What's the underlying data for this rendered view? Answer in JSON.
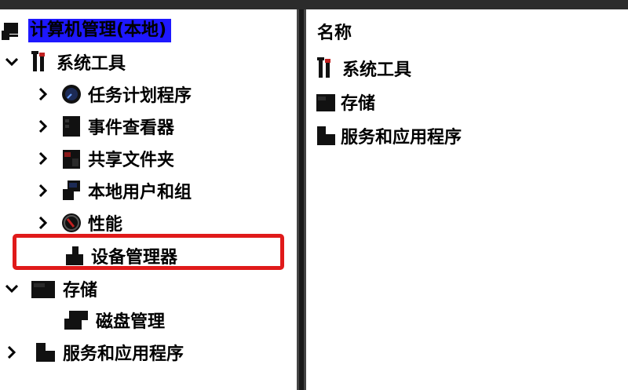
{
  "tree": {
    "root": {
      "label": "计算机管理(本地)",
      "icon": "computer-management-icon"
    },
    "items": [
      {
        "label": "系统工具",
        "icon": "tools-icon",
        "state": "expanded"
      },
      {
        "label": "任务计划程序",
        "icon": "clock-icon",
        "state": "collapsed"
      },
      {
        "label": "事件查看器",
        "icon": "event-viewer-icon",
        "state": "collapsed"
      },
      {
        "label": "共享文件夹",
        "icon": "shared-folder-icon",
        "state": "collapsed"
      },
      {
        "label": "本地用户和组",
        "icon": "users-icon",
        "state": "collapsed"
      },
      {
        "label": "性能",
        "icon": "performance-icon",
        "state": "collapsed"
      },
      {
        "label": "设备管理器",
        "icon": "device-manager-icon",
        "state": "none"
      },
      {
        "label": "存储",
        "icon": "storage-icon",
        "state": "expanded"
      },
      {
        "label": "磁盘管理",
        "icon": "disk-icon",
        "state": "none"
      },
      {
        "label": "服务和应用程序",
        "icon": "services-icon",
        "state": "collapsed"
      }
    ]
  },
  "list": {
    "header": "名称",
    "items": [
      {
        "label": "系统工具",
        "icon": "tools-icon"
      },
      {
        "label": "存储",
        "icon": "storage-icon"
      },
      {
        "label": "服务和应用程序",
        "icon": "services-icon"
      }
    ]
  },
  "colors": {
    "selection": "#1e18ff",
    "highlight_border": "#e01a1a",
    "splitter": "#1a1a1a"
  }
}
